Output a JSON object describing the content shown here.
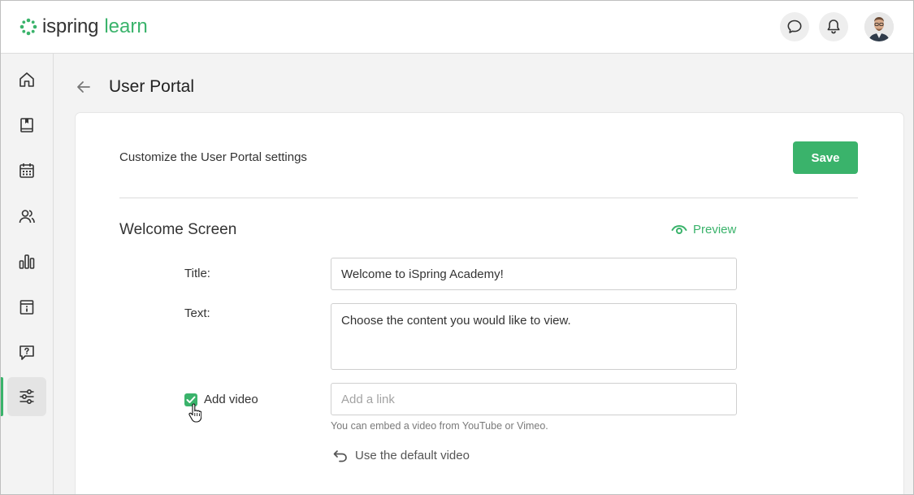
{
  "app": {
    "logo_word": "ispring",
    "logo_word2": "learn",
    "brand_color": "#3ab36b"
  },
  "header": {
    "icons": [
      "chat-icon",
      "bell-icon",
      "user-avatar"
    ]
  },
  "sidebar": {
    "items": [
      {
        "icon": "home-icon",
        "active": false
      },
      {
        "icon": "book-icon",
        "active": false
      },
      {
        "icon": "calendar-icon",
        "active": false
      },
      {
        "icon": "users-icon",
        "active": false
      },
      {
        "icon": "reports-icon",
        "active": false
      },
      {
        "icon": "info-icon",
        "active": false
      },
      {
        "icon": "help-icon",
        "active": false
      },
      {
        "icon": "settings-sliders-icon",
        "active": true
      }
    ]
  },
  "page": {
    "title": "User Portal",
    "subtitle": "Customize the User Portal settings",
    "save_label": "Save"
  },
  "welcome": {
    "section_title": "Welcome Screen",
    "preview_label": "Preview",
    "title_label": "Title:",
    "title_value": "Welcome to iSpring Academy!",
    "text_label": "Text:",
    "text_value": "Choose the content you would like to view.",
    "add_video_label": "Add video",
    "add_video_checked": true,
    "link_placeholder": "Add a link",
    "link_hint": "You can embed a video from YouTube or Vimeo.",
    "default_video_label": "Use the default video"
  }
}
